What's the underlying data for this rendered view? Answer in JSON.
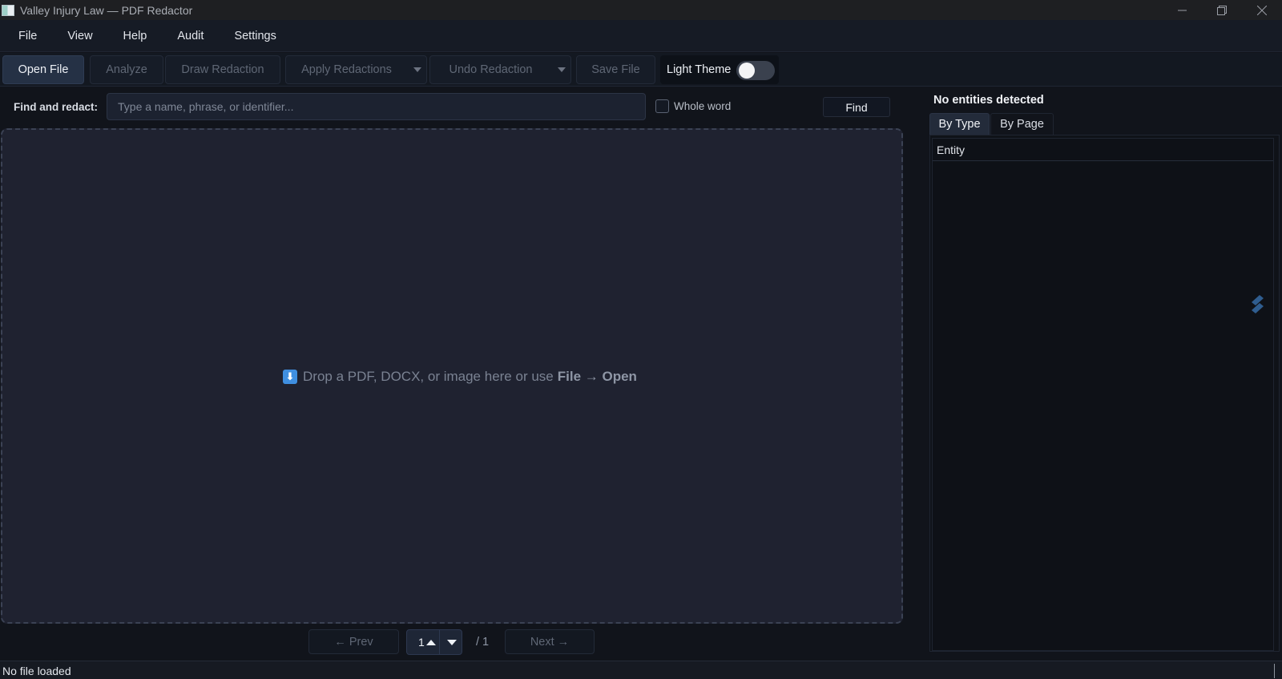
{
  "window": {
    "title": "Valley Injury Law — PDF Redactor"
  },
  "menu": [
    "File",
    "View",
    "Help",
    "Audit",
    "Settings"
  ],
  "toolbar": {
    "open_file": "Open File",
    "analyze": "Analyze",
    "draw_redaction": "Draw Redaction",
    "apply_redactions": "Apply Redactions",
    "undo_redaction": "Undo Redaction",
    "save_file": "Save File",
    "light_theme": "Light Theme",
    "light_theme_on": false
  },
  "find": {
    "label": "Find and redact:",
    "placeholder": "Type a name, phrase, or identifier...",
    "value": "",
    "whole_word_label": "Whole word",
    "whole_word_checked": false,
    "button": "Find"
  },
  "dropzone": {
    "text": "Drop a PDF, DOCX, or image here or use",
    "emphasis": "File → Open",
    "icon": "download-arrow-icon"
  },
  "pager": {
    "prev": "← Prev",
    "next": "Next →",
    "current": "1",
    "total": "/ 1"
  },
  "entities": {
    "title": "No entities detected",
    "tabs": [
      "By Type",
      "By Page"
    ],
    "active_tab": "By Type",
    "column_header": "Entity"
  },
  "status": {
    "text": "No file loaded"
  },
  "colors": {
    "accent": "#3f8fe0",
    "background": "#11141b",
    "panel": "#1f2230"
  }
}
